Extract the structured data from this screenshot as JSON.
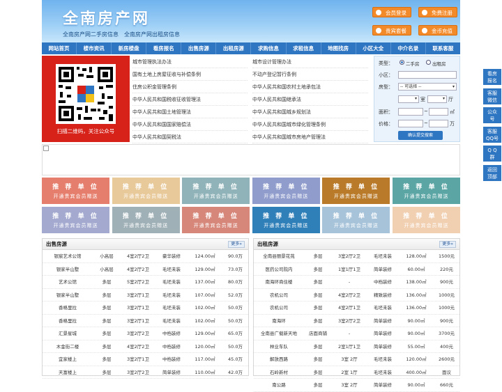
{
  "header": {
    "logo": "全南房产网",
    "slogan": "全南房产网二手房信息　全南房产网出租房信息",
    "buttons": {
      "login": "会员登录",
      "register": "免费注册",
      "vip": "贵宾套餐",
      "recharge": "金币充值"
    }
  },
  "nav": [
    "网站首页",
    "楼市资讯",
    "新房楼盘",
    "看房报名",
    "出售房源",
    "出租房源",
    "求购信息",
    "求租信息",
    "地图找房",
    "小区大全",
    "中介名录",
    "联系客服"
  ],
  "qr": {
    "caption": "扫描二维码，关注公众号"
  },
  "laws_left": [
    "城市管理执法办法",
    "国有土地上房屋征收与补偿条例",
    "住房公积金管理条例",
    "中华人民共和国税收征收管理法",
    "中华人民共和国土地管理法",
    "中华人民共和国国家赔偿法",
    "中华人民共和国契税法"
  ],
  "laws_right": [
    "城市设计管理办法",
    "不动产登记暂行条例",
    "中华人民共和国农村土地承包法",
    "中华人民共和国继承法",
    "中华人民共和国城乡规划法",
    "中华人民共和国城市绿化管理条例",
    "中华人民共和国城市房地产管理法"
  ],
  "search": {
    "type_label": "类型：",
    "opt1": "二手房",
    "opt2": "出租房",
    "community_label": "小区：",
    "house_label": "房型：",
    "select_placeholder": "-- 可选择 --",
    "room_unit": "室",
    "hall_unit": "厅",
    "area_label": "面积：",
    "area_unit": "㎡",
    "price_label": "价格：",
    "price_unit": "万",
    "submit": "确认提交搜索"
  },
  "ads": {
    "title": "推 荐 单 位",
    "subtitle": "开通贵宾会员赠送",
    "colors": [
      "#e57e6c",
      "#e8c99a",
      "#8fb3b8",
      "#8f9ccc",
      "#b97b2a",
      "#5ba5a5",
      "#a3a9cf",
      "#9fb0b6",
      "#d6877a",
      "#2f7fb8",
      "#a6c3d9",
      "#f1cfb1"
    ]
  },
  "sale": {
    "title": "出售房源",
    "more": "更多»",
    "rows": [
      [
        "银宸艺术公馆",
        "小高层",
        "4室2厅2卫",
        "豪华装修",
        "124.00㎡",
        "90.0万"
      ],
      [
        "银家半山墅",
        "小高层",
        "4室2厅2卫",
        "毛坯未装",
        "129.00㎡",
        "73.0万"
      ],
      [
        "艺术公馆",
        "多层",
        "5室2厅2卫",
        "毛坯未装",
        "137.00㎡",
        "80.0万"
      ],
      [
        "银家半山墅",
        "多层",
        "3室2厅1卫",
        "毛坯未装",
        "107.00㎡",
        "52.0万"
      ],
      [
        "香格里拉",
        "多层",
        "3室2厅1卫",
        "毛坯未装",
        "102.00㎡",
        "50.0万"
      ],
      [
        "香格里拉",
        "多层",
        "3室2厅1卫",
        "毛坯未装",
        "102.00㎡",
        "50.0万"
      ],
      [
        "汇景星城",
        "多层",
        "3室2厅2卫",
        "中档装修",
        "129.00㎡",
        "65.0万"
      ],
      [
        "木金街二楼",
        "多层",
        "4室2厅2卫",
        "中档装修",
        "120.00㎡",
        "50.0万"
      ],
      [
        "宜家楼上",
        "多层",
        "3室2厅1卫",
        "中档装修",
        "117.00㎡",
        "45.0万"
      ],
      [
        "天富楼上",
        "多层",
        "3室2厅2卫",
        "简单装修",
        "110.00㎡",
        "42.0万"
      ]
    ]
  },
  "rent": {
    "title": "出租房源",
    "more": "更多»",
    "rows": [
      [
        "全南县丽景花苑",
        "多层",
        "3室2厅2卫",
        "毛坯未装",
        "128.00㎡",
        "1500元"
      ],
      [
        "医药公司院内",
        "多层",
        "1室1厅1卫",
        "简单装修",
        "60.00㎡",
        "220元"
      ],
      [
        "南海环商住楼",
        "多层",
        "-",
        "中档装修",
        "138.00㎡",
        "900元"
      ],
      [
        "农机公司",
        "多层",
        "4室2厅2卫",
        "精致装修",
        "136.00㎡",
        "1000元"
      ],
      [
        "农机公司",
        "多层",
        "4室2厅1卫",
        "毛坯未装",
        "136.00㎡",
        "1000元"
      ],
      [
        "南海环",
        "多层",
        "3室2厅2卫",
        "简单装修",
        "90.00㎡",
        "900元"
      ],
      [
        "全南县广载新天地",
        "店面商铺",
        "-",
        "简单装修",
        "90.00㎡",
        "3700元"
      ],
      [
        "林业车队",
        "多层",
        "2室1厅1卫",
        "简单装修",
        "55.00㎡",
        "400元"
      ],
      [
        "解放西路",
        "多层",
        "3室 2厅",
        "毛坯未装",
        "120.00㎡",
        "2600元"
      ],
      [
        "石岭新村",
        "多层",
        "2室 1厅",
        "毛坯未装",
        "400.00㎡",
        "面议"
      ],
      [
        "南公路",
        "多层",
        "3室 2厅",
        "简单装修",
        "90.00㎡",
        "660元"
      ]
    ]
  },
  "side": [
    [
      "看房",
      "报名"
    ],
    [
      "客服",
      "微信"
    ],
    [
      "公众",
      "号"
    ],
    [
      "客服",
      "QQ号"
    ],
    [
      "Q Q",
      "群"
    ],
    [
      "返回",
      "顶部"
    ]
  ]
}
